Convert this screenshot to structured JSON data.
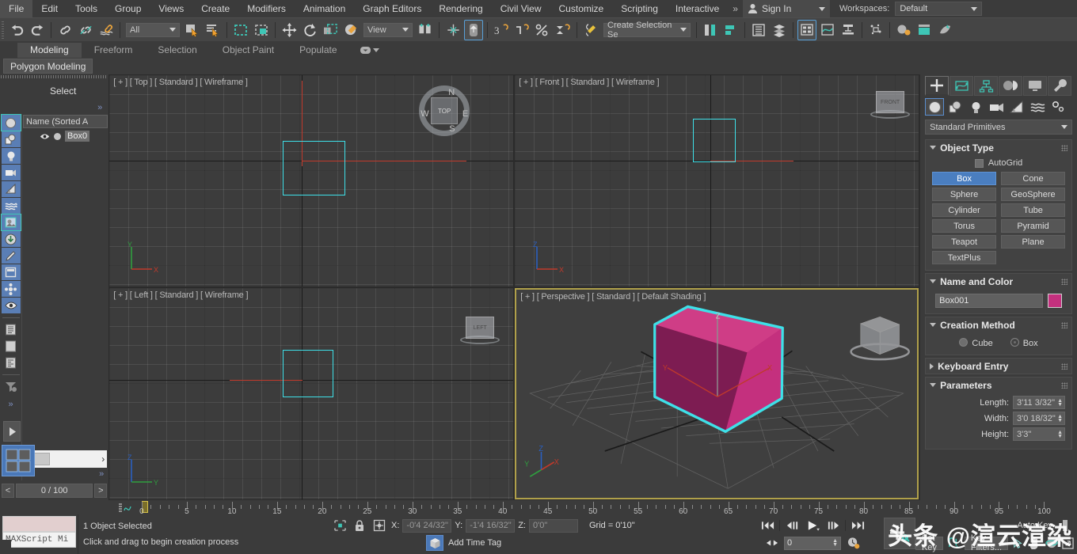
{
  "menubar": {
    "items": [
      "File",
      "Edit",
      "Tools",
      "Group",
      "Views",
      "Create",
      "Modifiers",
      "Animation",
      "Graph Editors",
      "Rendering",
      "Civil View",
      "Customize",
      "Scripting",
      "Interactive"
    ],
    "overflow": "»",
    "signin_label": "Sign In",
    "workspaces_label": "Workspaces:",
    "workspace_value": "Default"
  },
  "toolbar": {
    "undo_icon": "undo-icon",
    "redo_icon": "redo-icon",
    "selection_filter": "All",
    "reference_coord": "View",
    "named_selection_set": "Create Selection Se"
  },
  "ribbon": {
    "tabs": [
      "Modeling",
      "Freeform",
      "Selection",
      "Object Paint",
      "Populate"
    ],
    "active_tab": "Modeling",
    "panel_tab": "Polygon Modeling"
  },
  "scene_explorer": {
    "title": "Select",
    "expand_glyph": "»",
    "column_header": "Name (Sorted A",
    "rows": [
      {
        "name": "Box0",
        "visible_icon": "eye-icon"
      }
    ],
    "time_field": "0 / 100",
    "prev_glyph": "<",
    "next_glyph": ">",
    "scroll_left": "‹",
    "scroll_right": "›",
    "toolbar_icons": [
      "all-objects-icon",
      "geometry-icon",
      "lights-icon",
      "cameras-icon",
      "helpers-icon",
      "space-warps-icon",
      "groups-icon",
      "xrefs-icon",
      "bones-icon",
      "containers-icon",
      "particles-icon",
      "visibility-icon",
      "list-view-icon",
      "blank-view-icon",
      "detail-view-icon",
      "filter-icon"
    ],
    "more_glyph": "»"
  },
  "viewports": [
    {
      "label": "[ + ] [ Top ] [ Standard ] [ Wireframe ]",
      "name": "top"
    },
    {
      "label": "[ + ] [ Front ] [ Standard ] [ Wireframe ]",
      "name": "front"
    },
    {
      "label": "[ + ] [ Left ] [ Standard ] [ Wireframe ]",
      "name": "left"
    },
    {
      "label": "[ + ] [ Perspective ] [ Standard ] [ Default Shading ]",
      "name": "perspective"
    }
  ],
  "viewcube": {
    "top_face": "TOP",
    "compass_n": "N",
    "compass_s": "S",
    "compass_e": "E",
    "compass_w": "W",
    "front_face": "FRONT",
    "left_face": "LEFT"
  },
  "axis_labels": {
    "x": "X",
    "y": "Y",
    "z": "Z"
  },
  "command_panel": {
    "tabs": [
      "create-tab",
      "modify-tab",
      "hierarchy-tab",
      "motion-tab",
      "display-tab",
      "utilities-tab"
    ],
    "active_tab": "create-tab",
    "category_icons": [
      "geometry-icon",
      "shapes-icon",
      "lights-icon",
      "cameras-icon",
      "helpers-icon",
      "space-warps-icon",
      "systems-icon"
    ],
    "subcategory": "Standard Primitives",
    "object_type": {
      "title": "Object Type",
      "autogrid_label": "AutoGrid",
      "buttons": [
        "Box",
        "Cone",
        "Sphere",
        "GeoSphere",
        "Cylinder",
        "Tube",
        "Torus",
        "Pyramid",
        "Teapot",
        "Plane",
        "TextPlus"
      ],
      "active_button": "Box"
    },
    "name_and_color": {
      "title": "Name and Color",
      "name_value": "Box001",
      "color_hex": "#c4307e"
    },
    "creation_method": {
      "title": "Creation Method",
      "options": [
        "Cube",
        "Box"
      ],
      "selected": "Box"
    },
    "keyboard_entry": {
      "title": "Keyboard Entry"
    },
    "parameters": {
      "title": "Parameters",
      "rows": [
        {
          "label": "Length:",
          "value": "3'11 3/32\""
        },
        {
          "label": "Width:",
          "value": "3'0 18/32\""
        },
        {
          "label": "Height:",
          "value": "3'3\""
        }
      ]
    }
  },
  "timeline": {
    "min": 0,
    "max": 100,
    "step": 5,
    "labels": [
      "0",
      "5",
      "10",
      "15",
      "20",
      "25",
      "30",
      "35",
      "40",
      "45",
      "50",
      "55",
      "60",
      "65",
      "70",
      "75",
      "80",
      "85",
      "90",
      "95",
      "100"
    ],
    "current_frame": 0
  },
  "statusbar": {
    "maxscript_label": "MAXScript Mi",
    "selection_status": "1 Object Selected",
    "prompt": "Click and drag to begin creation process",
    "coords": [
      {
        "label": "X:",
        "value": "-0'4 24/32\""
      },
      {
        "label": "Y:",
        "value": "-1'4 16/32\""
      },
      {
        "label": "Z:",
        "value": "0'0\""
      }
    ],
    "grid_text": "Grid = 0'10\"",
    "add_time_tag": "Add Time Tag",
    "frame_value": "0",
    "auto_key": "Auto Key",
    "set_key": "Set Key",
    "key_filters": "Key Filters...",
    "selected_icon": "selection-lock-icon"
  },
  "watermark": "头条 @渲云渲染",
  "colors": {
    "accent_blue": "#4a7ec0",
    "selection_cyan": "#3ee0e8",
    "box_pink": "#c4307e",
    "active_viewport_border": "#b0a04a"
  }
}
